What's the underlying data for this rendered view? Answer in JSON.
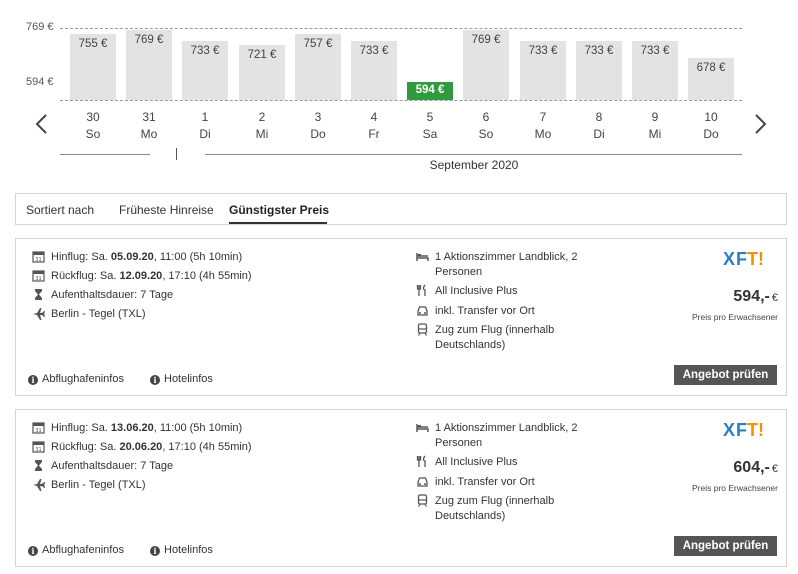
{
  "calendar": {
    "axis": {
      "high": "769 €",
      "low": "594 €"
    },
    "month_label": "September 2020",
    "selected_index": 10,
    "days": [
      {
        "num": "30",
        "dow": "So",
        "price": "755 €",
        "value": 755
      },
      {
        "num": "31",
        "dow": "Mo",
        "price": "769 €",
        "value": 769
      },
      {
        "num": "1",
        "dow": "Di",
        "price": "733 €",
        "value": 733
      },
      {
        "num": "2",
        "dow": "Mi",
        "price": "721 €",
        "value": 721
      },
      {
        "num": "3",
        "dow": "Do",
        "price": "757 €",
        "value": 757
      },
      {
        "num": "4",
        "dow": "Fr",
        "price": "733 €",
        "value": 733
      },
      {
        "num": "5",
        "dow": "Sa",
        "price": "594 €",
        "value": 594
      },
      {
        "num": "6",
        "dow": "So",
        "price": "769 €",
        "value": 769
      },
      {
        "num": "7",
        "dow": "Mo",
        "price": "733 €",
        "value": 733
      },
      {
        "num": "8",
        "dow": "Di",
        "price": "733 €",
        "value": 733
      },
      {
        "num": "9",
        "dow": "Mi",
        "price": "733 €",
        "value": 733
      },
      {
        "num": "10",
        "dow": "Do",
        "price": "678 €",
        "value": 678
      }
    ]
  },
  "sort": {
    "label": "Sortiert nach",
    "options": [
      "Früheste Hinreise",
      "Günstigster Preis"
    ],
    "active": "Günstigster Preis"
  },
  "offers": [
    {
      "outbound_prefix": "Hinflug: Sa. ",
      "outbound_date": "05.09.20",
      "outbound_suffix": ", 11:00 (5h 10min)",
      "return_prefix": "Rückflug: Sa. ",
      "return_date": "12.09.20",
      "return_suffix": ", 17:10 (4h 55min)",
      "stay": "Aufenthaltsdauer: 7 Tage",
      "airport": "Berlin - Tegel (TXL)",
      "room": "1 Aktionszimmer Landblick, 2 Personen",
      "board": "All Inclusive Plus",
      "transfer": "inkl. Transfer vor Ort",
      "train": "Zug zum Flug (innerhalb Deutschlands)",
      "price": "594,-",
      "currency": "€",
      "price_note": "Preis pro Erwachsener",
      "link_airport": "Abflughafeninfos",
      "link_hotel": "Hotelinfos",
      "cta": "Angebot prüfen",
      "logo": "XFT!"
    },
    {
      "outbound_prefix": "Hinflug: Sa. ",
      "outbound_date": "13.06.20",
      "outbound_suffix": ", 11:00 (5h 10min)",
      "return_prefix": "Rückflug: Sa. ",
      "return_date": "20.06.20",
      "return_suffix": ", 17:10 (4h 55min)",
      "stay": "Aufenthaltsdauer: 7 Tage",
      "airport": "Berlin - Tegel (TXL)",
      "room": "1 Aktionszimmer Landblick, 2 Personen",
      "board": "All Inclusive Plus",
      "transfer": "inkl. Transfer vor Ort",
      "train": "Zug zum Flug (innerhalb Deutschlands)",
      "price": "604,-",
      "currency": "€",
      "price_note": "Preis pro Erwachsener",
      "link_airport": "Abflughafeninfos",
      "link_hotel": "Hotelinfos",
      "cta": "Angebot prüfen",
      "logo": "XFT!"
    }
  ],
  "colors": {
    "selected_bar": "#2f9a3e",
    "bar": "#e3e3e3",
    "button": "#555555",
    "logo_blue": "#2a7fc1",
    "logo_orange": "#f39200"
  }
}
